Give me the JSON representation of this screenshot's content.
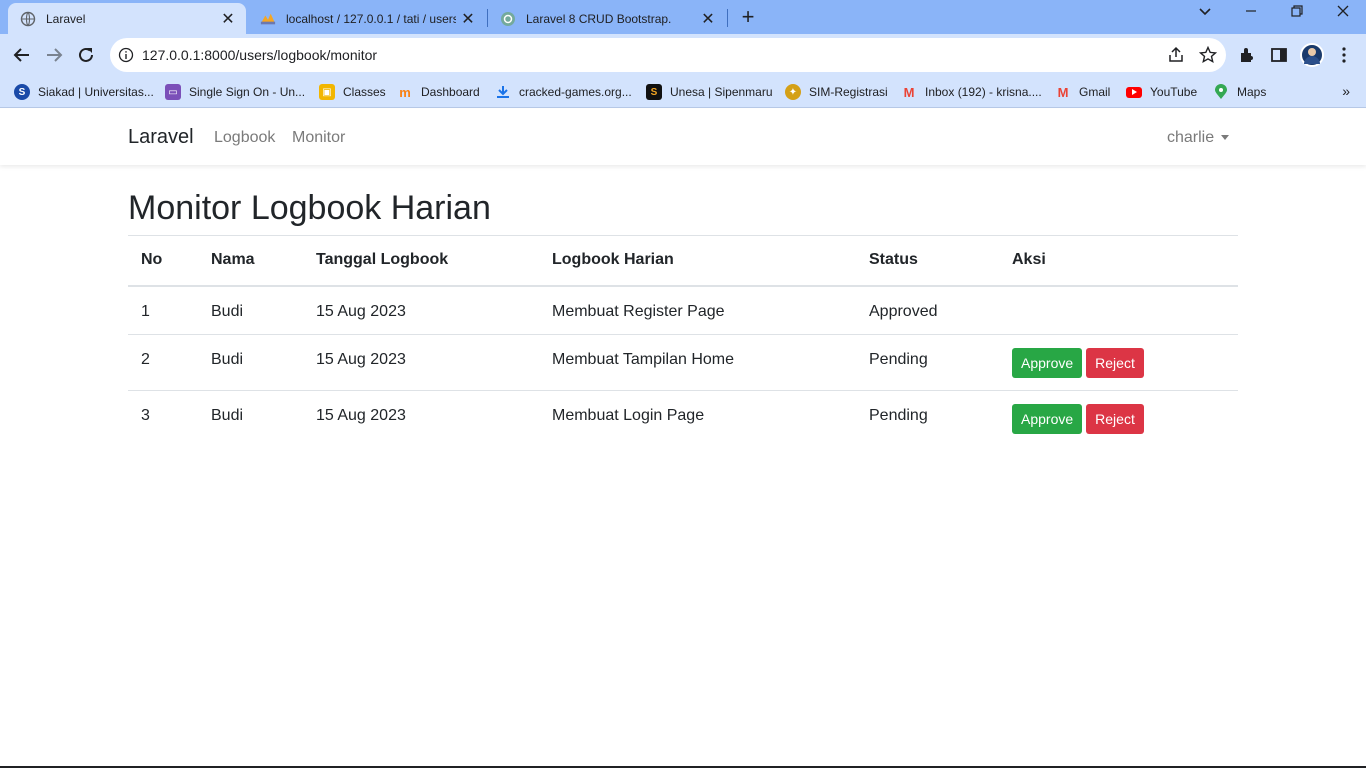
{
  "browser": {
    "tabs": [
      {
        "title": "Laravel",
        "active": true,
        "icon": "globe-icon"
      },
      {
        "title": "localhost / 127.0.0.1 / tati / users",
        "active": false,
        "icon": "phpmyadmin-icon"
      },
      {
        "title": "Laravel 8 CRUD Bootstrap.",
        "active": false,
        "icon": "openai-icon"
      }
    ],
    "new_tab": "+",
    "url": "127.0.0.1:8000/users/logbook/monitor",
    "bookmarks": [
      {
        "label": "Siakad | Universitas...",
        "icon": "siakad-icon",
        "color": "#1a4aa8"
      },
      {
        "label": "Single Sign On - Un...",
        "icon": "sso-icon",
        "color": "#7b4fb8"
      },
      {
        "label": "Classes",
        "icon": "classroom-icon",
        "color": "#f2b600"
      },
      {
        "label": "Dashboard",
        "icon": "moodle-icon",
        "color": "#f98012"
      },
      {
        "label": "cracked-games.org...",
        "icon": "download-icon",
        "color": "#1a73e8"
      },
      {
        "label": "Unesa | Sipenmaru",
        "icon": "sipenmaru-icon",
        "color": "#111111"
      },
      {
        "label": "SIM-Registrasi",
        "icon": "unesa-logo-icon",
        "color": "#d4a017"
      },
      {
        "label": "Inbox (192) - krisna....",
        "icon": "gmail-icon",
        "color": "#ea4335"
      },
      {
        "label": "Gmail",
        "icon": "gmail-icon",
        "color": "#ea4335"
      },
      {
        "label": "YouTube",
        "icon": "youtube-icon",
        "color": "#ff0000"
      },
      {
        "label": "Maps",
        "icon": "maps-icon",
        "color": "#34a853"
      }
    ]
  },
  "navbar": {
    "brand": "Laravel",
    "links": [
      "Logbook",
      "Monitor"
    ],
    "user": "charlie"
  },
  "main": {
    "title": "Monitor Logbook Harian",
    "table": {
      "headers": [
        "No",
        "Nama",
        "Tanggal Logbook",
        "Logbook Harian",
        "Status",
        "Aksi"
      ],
      "rows": [
        {
          "no": "1",
          "nama": "Budi",
          "tanggal": "15 Aug 2023",
          "logbook": "Membuat Register Page",
          "status": "Approved",
          "actions": false
        },
        {
          "no": "2",
          "nama": "Budi",
          "tanggal": "15 Aug 2023",
          "logbook": "Membuat Tampilan Home",
          "status": "Pending",
          "actions": true
        },
        {
          "no": "3",
          "nama": "Budi",
          "tanggal": "15 Aug 2023",
          "logbook": "Membuat Login Page",
          "status": "Pending",
          "actions": true
        }
      ],
      "approve_label": "Approve",
      "reject_label": "Reject"
    }
  },
  "colors": {
    "approve": "#28a745",
    "reject": "#dc3545",
    "chrome_frame": "#8ab4f8",
    "chrome_toolbar": "#d3e3fd"
  }
}
